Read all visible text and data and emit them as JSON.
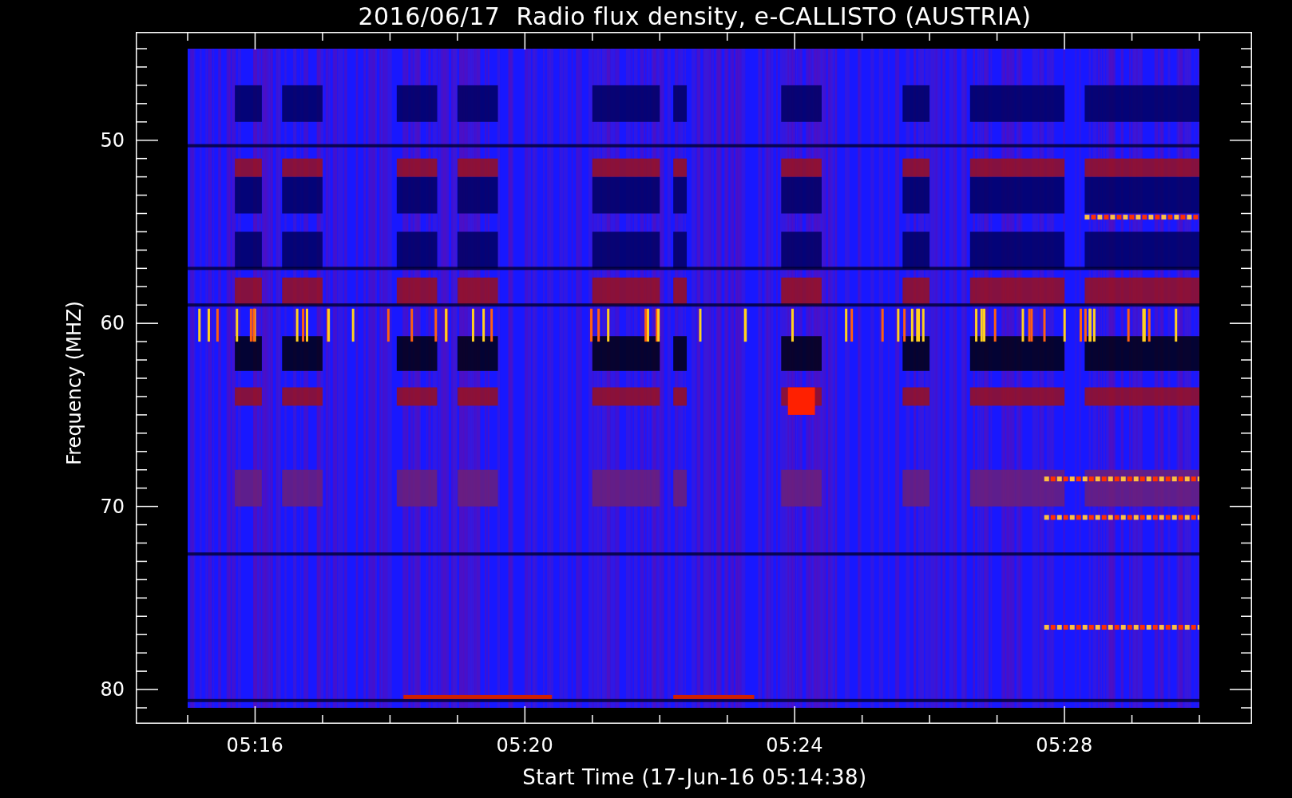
{
  "title": "2016/06/17  Radio flux density, e-CALLISTO (AUSTRIA)",
  "plot": {
    "kind": "spectrogram",
    "x_axis": {
      "label": "Start Time (17-Jun-16 05:14:38)",
      "ticks": [
        "05:16",
        "05:20",
        "05:24",
        "05:28"
      ]
    },
    "y_axis": {
      "label": "Frequency (MHZ)",
      "ticks": [
        "50",
        "60",
        "70",
        "80"
      ]
    }
  }
}
